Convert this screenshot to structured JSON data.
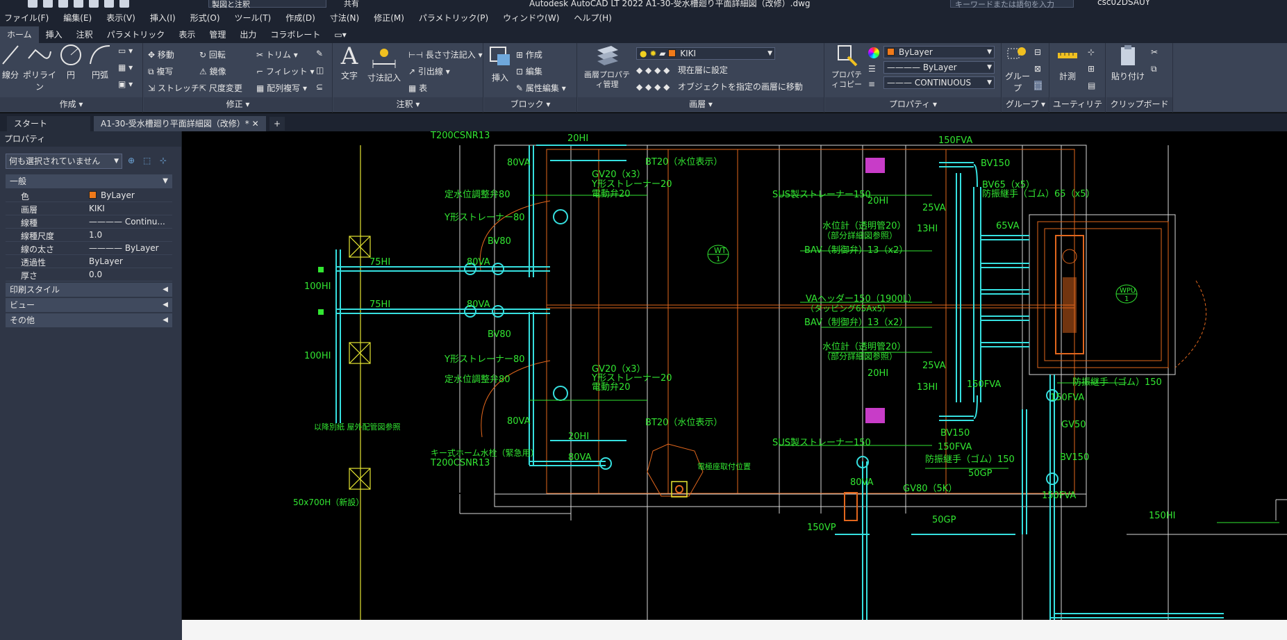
{
  "titlebar": {
    "workspace": "製図と注釈",
    "share": "共有",
    "app_title": "Autodesk AutoCAD LT 2022    A1-30-受水槽廻り平面詳細図（改修）.dwg",
    "keyword_placeholder": "キーワードまたは語句を入力",
    "user": "csc02DSAUY"
  },
  "menu": [
    "ファイル(F)",
    "編集(E)",
    "表示(V)",
    "挿入(I)",
    "形式(O)",
    "ツール(T)",
    "作成(D)",
    "寸法(N)",
    "修正(M)",
    "パラメトリック(P)",
    "ウィンドウ(W)",
    "ヘルプ(H)"
  ],
  "ribbon_tabs": [
    "ホーム",
    "挿入",
    "注釈",
    "パラメトリック",
    "表示",
    "管理",
    "出力",
    "コラボレート"
  ],
  "ribbon": {
    "create": {
      "title": "作成 ▾",
      "line": "線分",
      "polyline": "ポリライン",
      "circle": "円",
      "arc": "円弧"
    },
    "modify": {
      "title": "修正 ▾",
      "move": "移動",
      "rotate": "回転",
      "trim": "トリム",
      "copy": "複写",
      "mirror": "鏡像",
      "fillet": "フィレット",
      "stretch": "ストレッチ",
      "scale": "尺度変更",
      "array": "配列複写"
    },
    "annotation": {
      "title": "注釈 ▾",
      "text": "文字",
      "dimension": "寸法記入",
      "linear": "長さ寸法記入",
      "leader": "引出線",
      "table": "表"
    },
    "block": {
      "title": "ブロック ▾",
      "insert": "挿入",
      "create": "作成",
      "edit": "編集",
      "attr_edit": "属性編集"
    },
    "layer": {
      "title": "画層 ▾",
      "props": "画層プロパティ管理",
      "current_layer": "KIKI",
      "set_current": "現在層に設定",
      "match_layer": "オブジェクトを指定の画層に移動"
    },
    "properties": {
      "title": "プロパティ ▾",
      "copy": "プロパティコピー",
      "color": "ByLayer",
      "lineweight": "ByLayer",
      "linetype": "CONTINUOUS"
    },
    "group": {
      "title": "グループ ▾",
      "group": "グループ"
    },
    "utility": {
      "title": "ユーティリティ ▾",
      "measure": "計測"
    },
    "clipboard": {
      "title": "クリップボード",
      "paste": "貼り付け"
    }
  },
  "doc_tabs": {
    "start": "スタート",
    "current": "A1-30-受水槽廻り平面詳細図（改修）*  ✕",
    "plus": "+"
  },
  "palette": {
    "title": "プロパティ",
    "selection": "何も選択されていません",
    "general": "一般",
    "rows": [
      {
        "k": "色",
        "v": "ByLayer"
      },
      {
        "k": "画層",
        "v": "KIKI"
      },
      {
        "k": "線種",
        "v": "———— Continu..."
      },
      {
        "k": "線種尺度",
        "v": "1.0"
      },
      {
        "k": "線の太さ",
        "v": "———— ByLayer"
      },
      {
        "k": "透過性",
        "v": "ByLayer"
      },
      {
        "k": "厚さ",
        "v": "0.0"
      }
    ],
    "sections": [
      "印刷スタイル",
      "ビュー",
      "その他"
    ]
  },
  "drawing_labels": {
    "t200_top": "T200CSNR13",
    "hi20_top": "20HI",
    "va80_top": "80VA",
    "bt20_top": "BT20（水位表示）",
    "gv20_top": "GV20（x3）",
    "ystrainer20_top": "Y形ストレーナー20",
    "solenoid20_top": "電動弁20",
    "fixedlevel80_top": "定水位調整弁80",
    "ystrainer80_top": "Y形ストレーナー80",
    "bv80_top": "BV80",
    "hi75_top": "75HI",
    "va80_mid1": "80VA",
    "hi100_top": "100HI",
    "wt": "WT",
    "wt_num": "1",
    "sus150_top": "SUS製ストレーナー150",
    "hi20_right": "20HI",
    "va25_top": "25VA",
    "hi13_top": "13HI",
    "fva150_top": "150FVA",
    "bv150_top": "BV150",
    "bv65": "BV65（x5）",
    "flex65": "防振継手（ゴム）65（x5）",
    "va65": "65VA",
    "level_top": "水位計（透明管20）",
    "detail_top": "（部分詳細図参照）",
    "bav13_top": "BAV（制御弁）13（x2）",
    "header150": "VAヘッダー150（1900L）",
    "tapping": "（タッピング65Ax5）",
    "bav13_bot": "BAV（制御弁）13（x2）",
    "level_bot": "水位計（透明管20）",
    "detail_bot": "（部分詳細図参照）",
    "va25_bot": "25VA",
    "hi20_bot": "20HI",
    "hi13_bot": "13HI",
    "fva150_mid": "150FVA",
    "wpu": "WPU",
    "wpu_num": "1",
    "hi75_bot": "75HI",
    "va80_mid2": "80VA",
    "bv80_bot": "BV80",
    "ystrainer80_bot": "Y形ストレーナー80",
    "fixedlevel80_bot": "定水位調整弁80",
    "gv20_bot": "GV20（x3）",
    "ystrainer20_bot": "Y形ストレーナー20",
    "solenoid20_bot": "電動弁20",
    "hi100_bot": "100HI",
    "note_outdoor": "以降別紙  屋外配管図参照",
    "va80_bot": "80VA",
    "bt20_bot": "BT20（水位表示）",
    "hi20_bot2": "20HI",
    "hose": "キー式ホーム水栓（緊急用）",
    "t200_bot": "T200CSNR13",
    "va80_bot2": "80VA",
    "electrode": "電極座取付位置",
    "sus150_bot": "SUS製ストレーナー150",
    "bv150_bot": "BV150",
    "fva150_bot": "150FVA",
    "flex150_bot": "防振継手（ゴム）150",
    "flex150_right": "防振継手（ゴム）150",
    "fva150_right": "150FVA",
    "gv50": "GV50",
    "bv150_right": "BV150",
    "gp50": "50GP",
    "fva150_right2": "150FVA",
    "va80_pump": "80VA",
    "gv80": "GV80（5K）",
    "gp50_bot": "50GP",
    "vp150": "150VP",
    "hi150": "150HI",
    "h700": "50x700H（新設）"
  },
  "colors": {
    "cad_green": "#32e632",
    "cad_cyan": "#36e0e0",
    "cad_orange": "#e2671d",
    "cad_white": "#e8e8e8",
    "cad_yellow": "#e6e632",
    "cad_magenta": "#c83cc8"
  }
}
